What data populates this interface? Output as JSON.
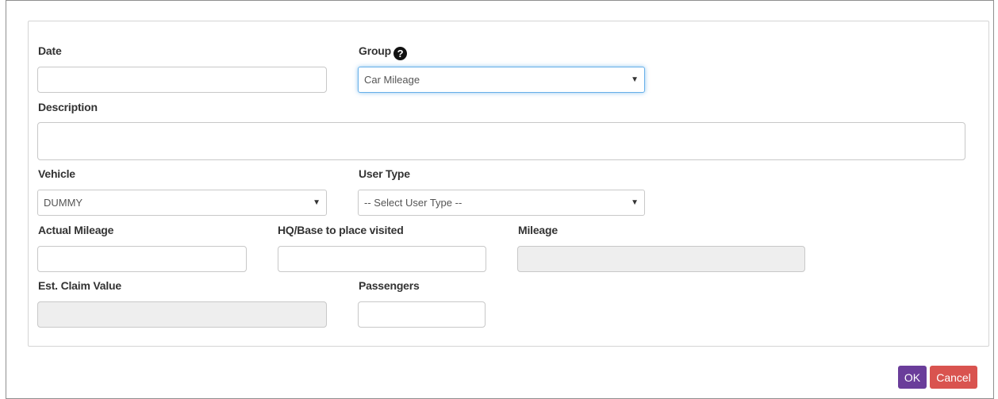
{
  "form": {
    "date": {
      "label": "Date",
      "value": ""
    },
    "group": {
      "label": "Group",
      "selected": "Car Mileage",
      "help_icon": "question-circle-icon"
    },
    "description": {
      "label": "Description",
      "value": ""
    },
    "vehicle": {
      "label": "Vehicle",
      "selected": "DUMMY"
    },
    "user_type": {
      "label": "User Type",
      "selected": "-- Select User Type --"
    },
    "actual_mileage": {
      "label": "Actual Mileage",
      "value": ""
    },
    "hq_base": {
      "label": "HQ/Base to place visited",
      "value": ""
    },
    "mileage": {
      "label": "Mileage",
      "value": ""
    },
    "est_claim_value": {
      "label": "Est. Claim Value",
      "value": ""
    },
    "passengers": {
      "label": "Passengers",
      "value": ""
    }
  },
  "buttons": {
    "ok": "OK",
    "cancel": "Cancel"
  },
  "colors": {
    "ok": "#6a3d9a",
    "cancel": "#d9534f",
    "focus": "#66afe9",
    "disabled_bg": "#eeeeee"
  }
}
